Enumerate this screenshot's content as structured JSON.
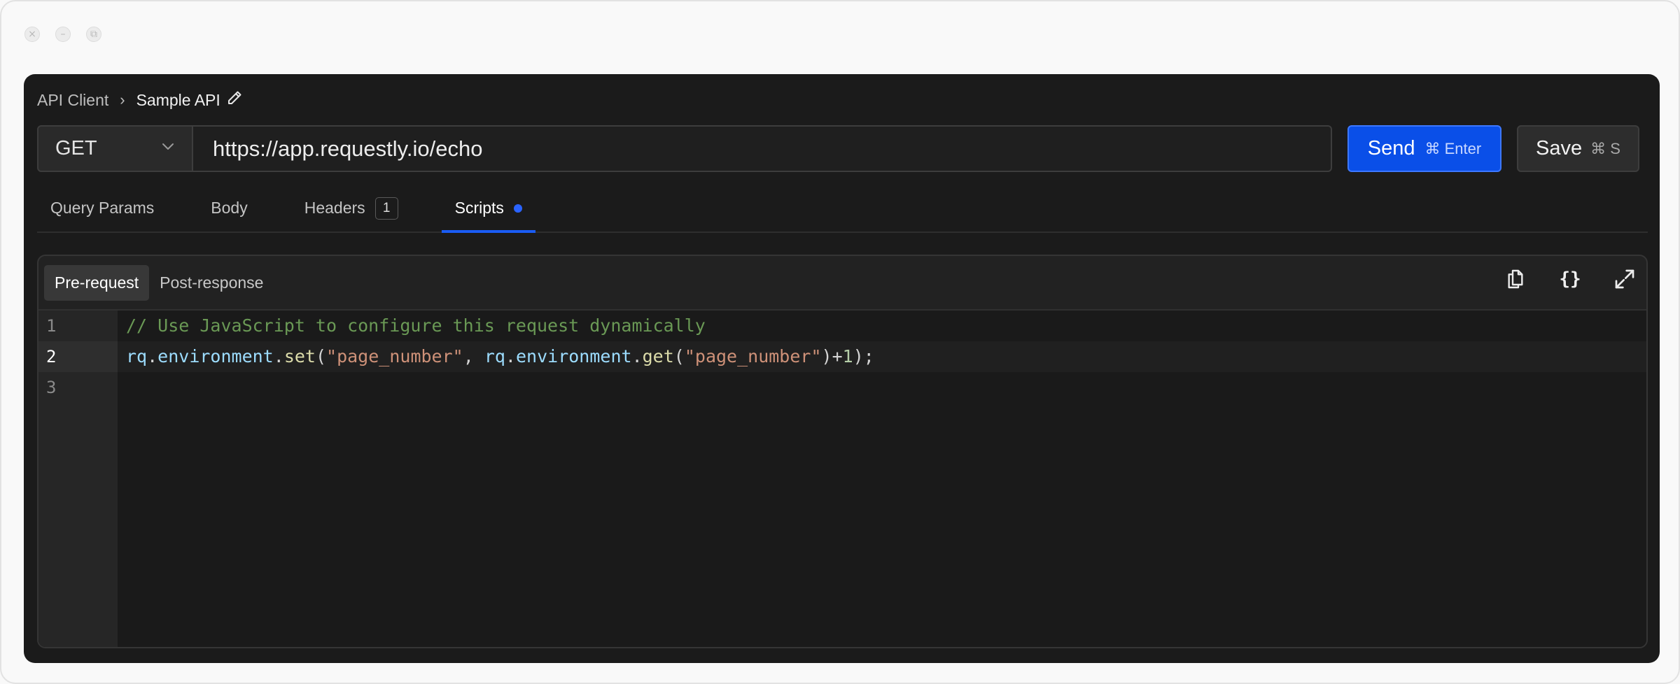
{
  "window": {
    "controls": [
      "close-icon",
      "minimize-icon",
      "maximize-icon"
    ]
  },
  "breadcrumb": {
    "root": "API Client",
    "separator": "›",
    "current": "Sample API"
  },
  "request": {
    "method": "GET",
    "url": "https://app.requestly.io/echo",
    "send_label": "Send",
    "send_shortcut": "⌘ Enter",
    "save_label": "Save",
    "save_shortcut": "⌘ S"
  },
  "tabs": [
    {
      "label": "Query Params"
    },
    {
      "label": "Body"
    },
    {
      "label": "Headers",
      "badge": "1"
    },
    {
      "label": "Scripts",
      "active": true,
      "indicator": true
    }
  ],
  "editor": {
    "sub_tabs": [
      {
        "label": "Pre-request",
        "active": true
      },
      {
        "label": "Post-response"
      }
    ],
    "toolbar_icons": [
      "copy-icon",
      "format-braces-icon",
      "expand-icon"
    ],
    "braces_glyph": "{}",
    "line_numbers": [
      "1",
      "2",
      "3"
    ],
    "current_line": 2,
    "code": {
      "line1": "// Use JavaScript to configure this request dynamically",
      "line2": {
        "t1": "rq",
        "t2": ".",
        "t3": "environment",
        "t4": ".",
        "t5": "set",
        "t6": "(",
        "t7": "\"page_number\"",
        "t8": ", ",
        "t9": "rq",
        "t10": ".",
        "t11": "environment",
        "t12": ".",
        "t13": "get",
        "t14": "(",
        "t15": "\"page_number\"",
        "t16": ")",
        "t17": "+",
        "t18": "1",
        "t19": ");"
      },
      "line3": ""
    }
  },
  "colors": {
    "accent": "#0a4fe8",
    "background": "#1b1b1b",
    "comment": "#6a9955",
    "string": "#ce9178",
    "identifier": "#9cdcfe"
  }
}
